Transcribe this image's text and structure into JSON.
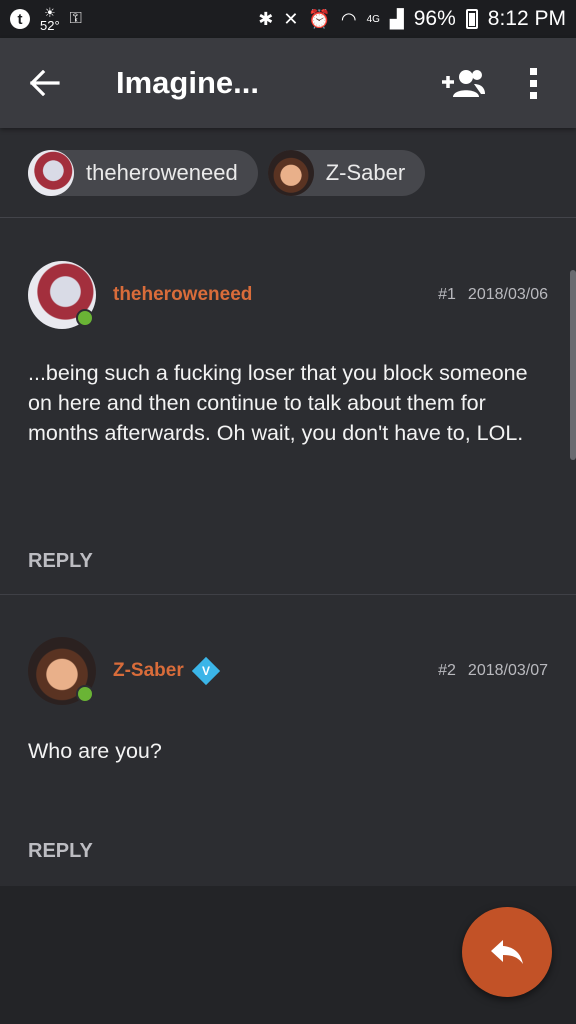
{
  "status_bar": {
    "temperature": "52°",
    "battery_percent": "96%",
    "time": "8:12 PM",
    "network": "4G"
  },
  "app_bar": {
    "title": "Imagine...",
    "back_icon": "arrow-left-icon",
    "add_people_icon": "add-person-icon",
    "more_icon": "more-vert-icon"
  },
  "participants": [
    {
      "name": "theheroweneed",
      "avatar": "pony-avatar"
    },
    {
      "name": "Z-Saber",
      "avatar": "man-avatar"
    }
  ],
  "posts": [
    {
      "author": "theheroweneed",
      "number": "#1",
      "date": "2018/03/06",
      "text": "...being such a fucking loser that you block someone on here and then continue to talk about them for months afterwards. Oh wait, you don't have to, LOL.",
      "reply_label": "REPLY",
      "verified": false
    },
    {
      "author": "Z-Saber",
      "number": "#2",
      "date": "2018/03/07",
      "text": "Who are you?",
      "reply_label": "REPLY",
      "verified": true,
      "badge_letter": "V"
    }
  ],
  "colors": {
    "accent": "#d96c3a",
    "fab": "#c25227",
    "online": "#6ab435",
    "badge": "#3bb5e8"
  },
  "fab_icon": "reply-icon"
}
